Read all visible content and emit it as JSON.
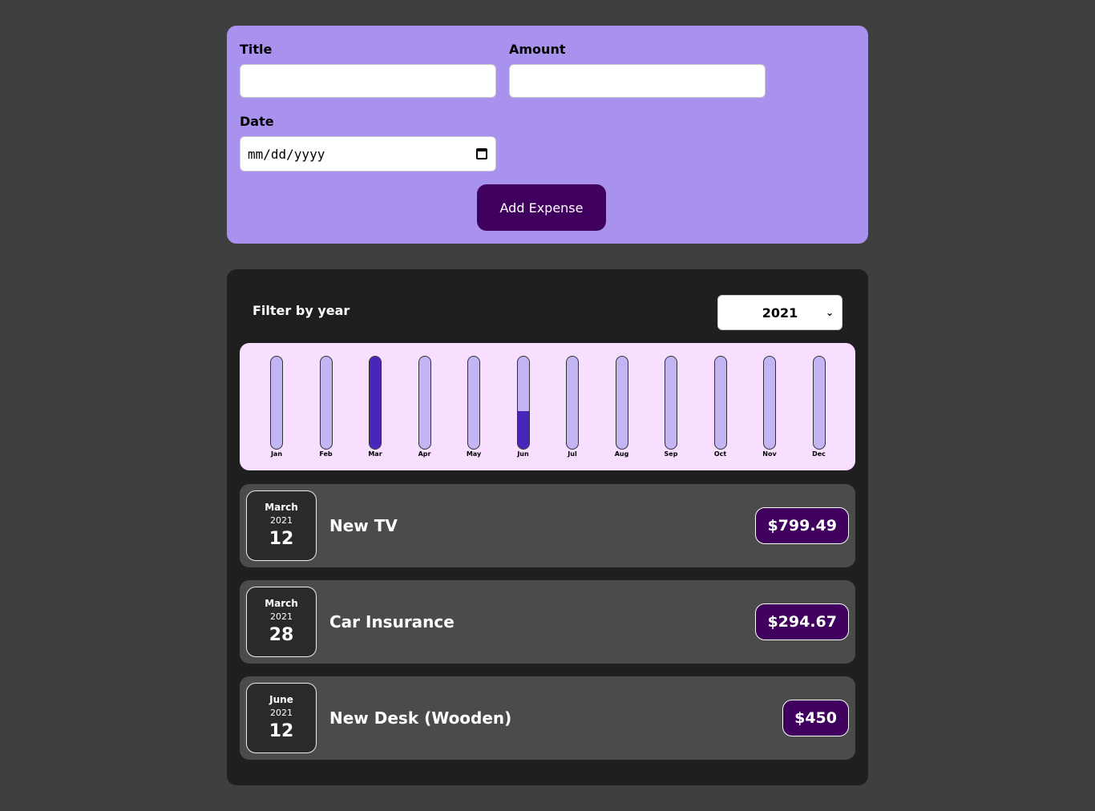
{
  "form": {
    "title_label": "Title",
    "amount_label": "Amount",
    "date_label": "Date",
    "title_value": "",
    "amount_value": "",
    "date_placeholder": "mm/dd/yyyy",
    "submit_label": "Add Expense"
  },
  "filter": {
    "label": "Filter by year",
    "selected_year": "2021"
  },
  "chart_data": {
    "type": "bar",
    "categories": [
      "Jan",
      "Feb",
      "Mar",
      "Apr",
      "May",
      "Jun",
      "Jul",
      "Aug",
      "Sep",
      "Oct",
      "Nov",
      "Dec"
    ],
    "values": [
      0,
      0,
      799.49,
      0,
      0,
      450,
      0,
      0,
      0,
      0,
      0,
      0
    ],
    "fill_fraction": [
      0,
      0,
      1.0,
      0,
      0,
      0.41,
      0,
      0,
      0,
      0,
      0,
      0
    ]
  },
  "expenses": [
    {
      "month": "March",
      "year": "2021",
      "day": "12",
      "title": "New TV",
      "amount": "$799.49"
    },
    {
      "month": "March",
      "year": "2021",
      "day": "28",
      "title": "Car Insurance",
      "amount": "$294.67"
    },
    {
      "month": "June",
      "year": "2021",
      "day": "12",
      "title": "New Desk (Wooden)",
      "amount": "$450"
    }
  ],
  "colors": {
    "form_bg": "#a892ee",
    "button_bg": "#40005d",
    "chart_bg": "#f8dfff",
    "bar_empty": "#c3b4f3",
    "bar_fill": "#4826b9"
  }
}
